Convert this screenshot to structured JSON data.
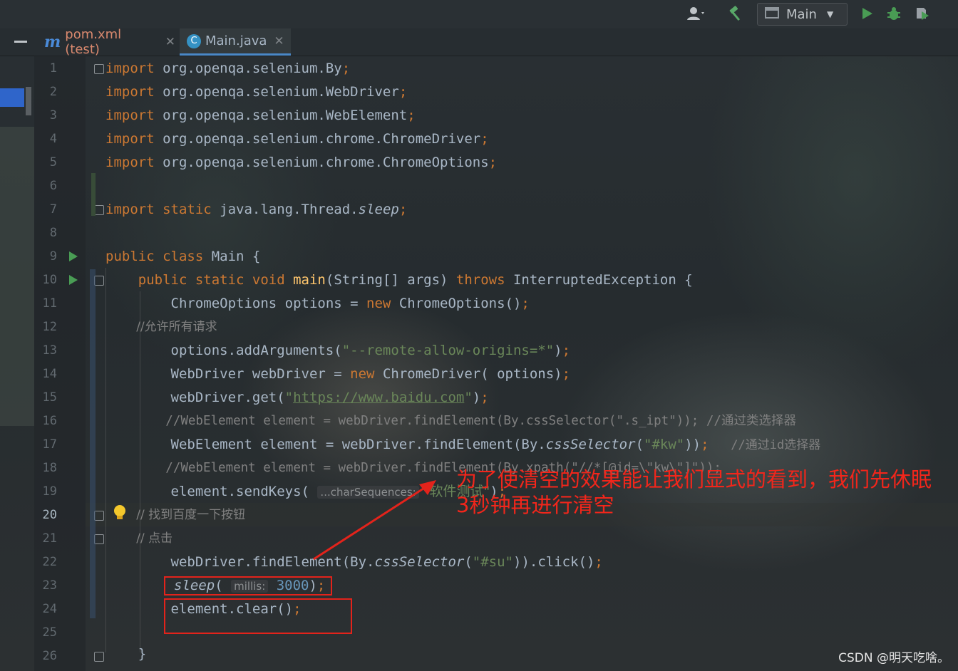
{
  "toolbar": {
    "run_config_label": "Main"
  },
  "tabs": [
    {
      "label": "pom.xml (test)",
      "icon": "maven-m-icon",
      "active": false
    },
    {
      "label": "Main.java",
      "icon": "java-class-icon",
      "active": true
    }
  ],
  "line_numbers": [
    "1",
    "2",
    "3",
    "4",
    "5",
    "6",
    "7",
    "8",
    "9",
    "10",
    "11",
    "12",
    "13",
    "14",
    "15",
    "16",
    "17",
    "18",
    "19",
    "20",
    "21",
    "22",
    "23",
    "24",
    "25",
    "26"
  ],
  "current_line": "20",
  "code": {
    "l1_a": "import",
    "l1_b": " org.openqa.selenium.By",
    "l1_c": ";",
    "l2_a": "import",
    "l2_b": " org.openqa.selenium.WebDriver",
    "l2_c": ";",
    "l3_a": "import",
    "l3_b": " org.openqa.selenium.WebElement",
    "l3_c": ";",
    "l4_a": "import",
    "l4_b": " org.openqa.selenium.chrome.ChromeDriver",
    "l4_c": ";",
    "l5_a": "import",
    "l5_b": " org.openqa.selenium.chrome.ChromeOptions",
    "l5_c": ";",
    "l7_a": "import static",
    "l7_b": " java.lang.Thread.",
    "l7_c": "sleep",
    "l7_d": ";",
    "l9_a": "public class",
    "l9_b": " Main {",
    "l10_a": "    public static void ",
    "l10_b": "main",
    "l10_c": "(String[] args) ",
    "l10_d": "throws",
    "l10_e": " InterruptedException {",
    "l11_a": "        ChromeOptions options = ",
    "l11_b": "new",
    "l11_c": " ChromeOptions()",
    "l11_d": ";",
    "l12": "        //允许所有请求",
    "l13_a": "        options.addArguments(",
    "l13_b": "\"--remote-allow-origins=*\"",
    "l13_c": ")",
    "l13_d": ";",
    "l14_a": "        WebDriver webDriver = ",
    "l14_b": "new",
    "l14_c": " ChromeDriver( options)",
    "l14_d": ";",
    "l15_a": "        webDriver.get(",
    "l15_q1": "\"",
    "l15_url": "https://www.baidu.com",
    "l15_q2": "\"",
    "l15_c": ")",
    "l15_d": ";",
    "l16": "        //WebElement element = webDriver.findElement(By.cssSelector(\".s_ipt\")); //通过类选择器",
    "l17_a": "        WebElement element = webDriver.findElement(By.",
    "l17_b": "cssSelector",
    "l17_c": "(",
    "l17_d": "\"#kw\"",
    "l17_e": "))",
    "l17_f": ";",
    "l17_g": "   //通过id选择器",
    "l18": "        //WebElement element = webDriver.findElement(By.xpath(\"//*[@id=\\\"kw\\\"]\"));",
    "l19_a": "        element.sendKeys( ",
    "l19_hint": "...charSequences:",
    "l19_b": " \"软件测试\"",
    "l19_c": ")",
    "l19_d": ";",
    "l20": "        // 找到百度一下按钮",
    "l21": "        // 点击",
    "l22_a": "        webDriver.findElement(By.",
    "l22_b": "cssSelector",
    "l22_c": "(",
    "l22_d": "\"#su\"",
    "l22_e": ")).click()",
    "l22_f": ";",
    "l23_a": "sleep",
    "l23_b": "( ",
    "l23_hint": "millis:",
    "l23_num": " 3000",
    "l23_c": ")",
    "l23_d": ";",
    "l24_a": "        element.clear()",
    "l24_b": ";",
    "l26": "    }"
  },
  "annotation": {
    "line1": "为了使清空的效果能让我们显式的看到，我们先休眠",
    "line2": "3秒钟再进行清空"
  },
  "watermark": "CSDN @明天吃啥。",
  "colors": {
    "keyword": "#cc7832",
    "string": "#6a8759",
    "comment": "#808080",
    "method": "#ffc66d",
    "number": "#6897bb",
    "annotation_red": "#e3231b"
  }
}
